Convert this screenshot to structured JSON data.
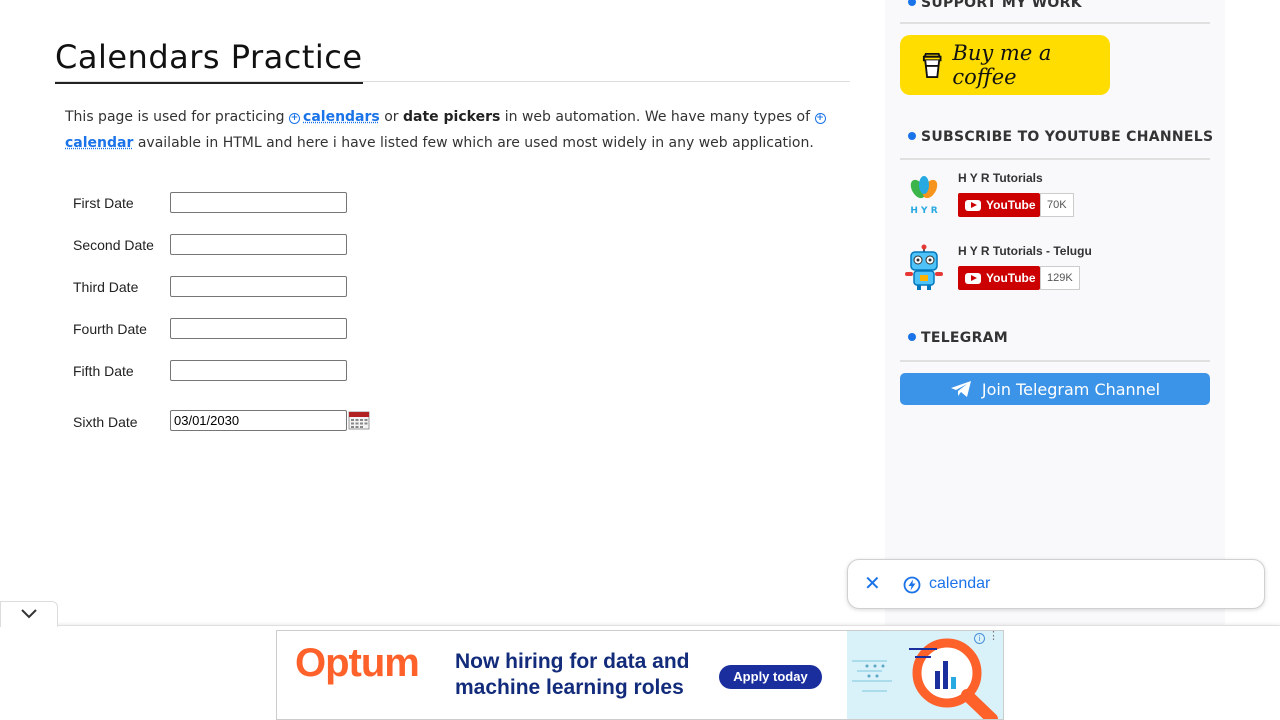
{
  "main": {
    "title": "Calendars Practice",
    "intro": {
      "text1": "This page is used for practicing ",
      "link1": "calendars",
      "text2": " or ",
      "bold1": "date pickers",
      "text3": " in web automation. We have many types of ",
      "link2": "calendar",
      "text4": " available in HTML and here i have listed few which are used most widely in any web application."
    },
    "dates": [
      {
        "label": "First Date",
        "value": ""
      },
      {
        "label": "Second Date",
        "value": ""
      },
      {
        "label": "Third Date",
        "value": ""
      },
      {
        "label": "Fourth Date",
        "value": ""
      },
      {
        "label": "Fifth Date",
        "value": ""
      },
      {
        "label": "Sixth Date",
        "value": "03/01/2030"
      }
    ]
  },
  "sidebar": {
    "support_title": "SUPPORT MY WORK",
    "coffee_label": "Buy me a coffee",
    "youtube_title": "SUBSCRIBE TO YOUTUBE CHANNELS",
    "channels": [
      {
        "name": "H Y R Tutorials",
        "button": "YouTube",
        "count": "70K"
      },
      {
        "name": "H Y R Tutorials - Telugu",
        "button": "YouTube",
        "count": "129K"
      }
    ],
    "telegram_title": "TELEGRAM",
    "telegram_button": "Join Telegram Channel"
  },
  "search_chip": {
    "query": "calendar"
  },
  "ad": {
    "brand": "Optum",
    "headline": "Now hiring for data and machine learning roles",
    "cta": "Apply today"
  },
  "colors": {
    "accent": "#1a73e8",
    "coffee_yellow": "#ffdd00",
    "telegram_blue": "#3b94e8",
    "youtube_red": "#cc0000",
    "optum_orange": "#ff612b"
  }
}
